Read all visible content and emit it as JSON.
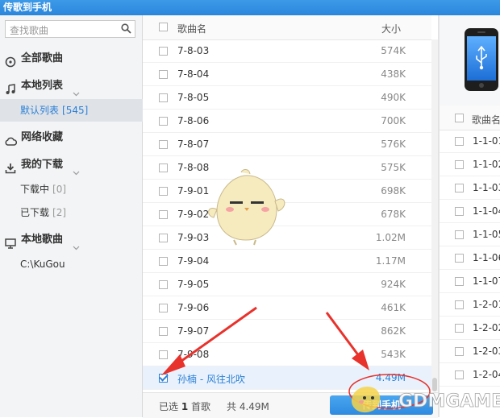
{
  "window": {
    "title": "传歌到手机"
  },
  "sidebar": {
    "search_placeholder": "查找歌曲",
    "all_songs": "全部歌曲",
    "local_list": "本地列表",
    "default_list": "默认列表",
    "default_list_count": "[545]",
    "cloud_favorites": "网络收藏",
    "my_downloads": "我的下载",
    "downloading": "下载中",
    "downloading_count": "[0]",
    "downloaded": "已下载",
    "downloaded_count": "[2]",
    "local_songs": "本地歌曲",
    "local_path": "C:\\KuGou"
  },
  "song_list": {
    "header_name": "歌曲名",
    "header_size": "大小",
    "rows": [
      {
        "name": "7-8-03",
        "size": "574K"
      },
      {
        "name": "7-8-04",
        "size": "438K"
      },
      {
        "name": "7-8-05",
        "size": "490K"
      },
      {
        "name": "7-8-06",
        "size": "700K"
      },
      {
        "name": "7-8-07",
        "size": "576K"
      },
      {
        "name": "7-8-08",
        "size": "575K"
      },
      {
        "name": "7-9-01",
        "size": "698K"
      },
      {
        "name": "7-9-02",
        "size": "678K"
      },
      {
        "name": "7-9-03",
        "size": "1.02M"
      },
      {
        "name": "7-9-04",
        "size": "1.17M"
      },
      {
        "name": "7-9-05",
        "size": "924K"
      },
      {
        "name": "7-9-06",
        "size": "461K"
      },
      {
        "name": "7-9-07",
        "size": "862K"
      },
      {
        "name": "7-9-08",
        "size": "543K"
      },
      {
        "name": "孙楠 - 风往北吹",
        "size": "4.49M",
        "checked": true
      }
    ],
    "footer_selected_prefix": "已选",
    "footer_selected_count": "1",
    "footer_selected_suffix": "首歌",
    "footer_total": "共 4.49M",
    "transfer_button": "传到手机"
  },
  "phone": {
    "header_name": "歌曲名",
    "rows": [
      "1-1-01",
      "1-1-02",
      "1-1-03",
      "1-1-04",
      "1-1-05",
      "1-1-06",
      "1-1-07",
      "1-2-01",
      "1-2-02",
      "1-2-03",
      "1-2-04"
    ]
  },
  "watermark": {
    "text": "GDMGAME"
  },
  "colors": {
    "accent": "#2b7fd6",
    "arrow": "#e8322c",
    "titlebar": "#2a86dc"
  }
}
